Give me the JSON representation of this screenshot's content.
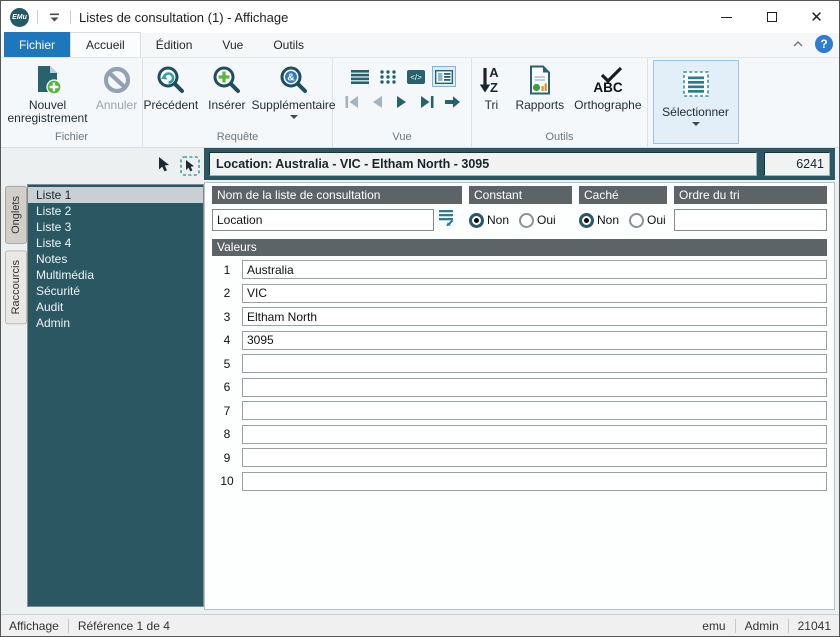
{
  "window": {
    "logo": "EMu",
    "title": "Listes de consultation (1) - Affichage"
  },
  "tabs": {
    "file": "Fichier",
    "items": [
      "Accueil",
      "Édition",
      "Vue",
      "Outils"
    ]
  },
  "ribbon": {
    "groups": {
      "fichier": {
        "label": "Fichier",
        "new_record": "Nouvel enregistrement",
        "cancel": "Annuler"
      },
      "requete": {
        "label": "Requête",
        "previous": "Précédent",
        "insert": "Insérer",
        "additional": "Supplémentaire"
      },
      "vue": {
        "label": "Vue"
      },
      "outils": {
        "label": "Outils",
        "sort": "Tri",
        "reports": "Rapports",
        "spelling": "Orthographe"
      },
      "select": {
        "label": "Sélectionner"
      }
    }
  },
  "record_header": {
    "title": "Location: Australia - VIC - Eltham North - 3095",
    "number": "6241"
  },
  "side_tabs": {
    "tabs_label": "Onglets",
    "shortcuts_label": "Raccourcis"
  },
  "sidebar": {
    "items": [
      {
        "label": "Liste 1",
        "selected": true
      },
      {
        "label": "Liste 2"
      },
      {
        "label": "Liste 3"
      },
      {
        "label": "Liste 4"
      },
      {
        "label": "Notes"
      },
      {
        "label": "Multimédia"
      },
      {
        "label": "Sécurité"
      },
      {
        "label": "Audit"
      },
      {
        "label": "Admin"
      }
    ]
  },
  "form": {
    "name_header": "Nom de la liste de consultation",
    "name_value": "Location",
    "constant_header": "Constant",
    "constant_value": "Non",
    "hidden_header": "Caché",
    "hidden_value": "Non",
    "sort_header": "Ordre du tri",
    "sort_value": "",
    "radio_no": "Non",
    "radio_yes": "Oui",
    "values_header": "Valeurs",
    "values": [
      {
        "n": "1",
        "v": "Australia"
      },
      {
        "n": "2",
        "v": "VIC"
      },
      {
        "n": "3",
        "v": "Eltham North"
      },
      {
        "n": "4",
        "v": "3095"
      },
      {
        "n": "5",
        "v": ""
      },
      {
        "n": "6",
        "v": ""
      },
      {
        "n": "7",
        "v": ""
      },
      {
        "n": "8",
        "v": ""
      },
      {
        "n": "9",
        "v": ""
      },
      {
        "n": "10",
        "v": ""
      }
    ]
  },
  "status_bar": {
    "mode": "Affichage",
    "reference": "Référence 1 de 4",
    "user": "emu",
    "group": "Admin",
    "record_id": "21041"
  },
  "colors": {
    "accent_blue": "#1e76bd",
    "dark_teal": "#2b5763",
    "icon_teal": "#27626f",
    "header_gray": "#5d6468"
  }
}
